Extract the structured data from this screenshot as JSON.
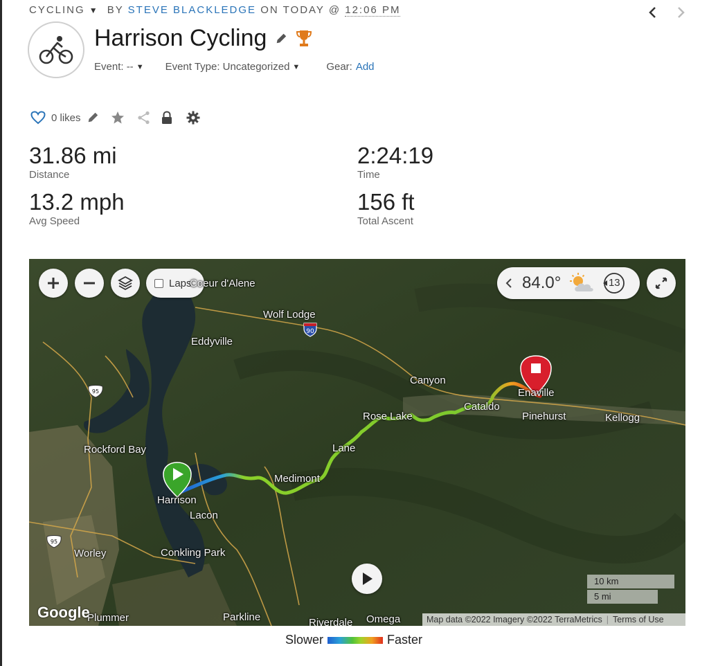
{
  "header": {
    "activity_type": "CYCLING",
    "by_label": "BY",
    "author": "STEVE BLACKLEDGE",
    "on_label": "ON TODAY @",
    "time": "12:06 PM"
  },
  "activity": {
    "title": "Harrison Cycling",
    "event_label": "Event: --",
    "event_type_label": "Event Type: Uncategorized",
    "gear_label": "Gear:",
    "gear_add": "Add"
  },
  "actions": {
    "likes": "0 likes"
  },
  "stats": {
    "distance": {
      "value": "31.86 mi",
      "label": "Distance"
    },
    "time": {
      "value": "2:24:19",
      "label": "Time"
    },
    "avg_speed": {
      "value": "13.2 mph",
      "label": "Avg Speed"
    },
    "total_ascent": {
      "value": "156 ft",
      "label": "Total Ascent"
    }
  },
  "map": {
    "laps_label": "Laps",
    "weather": {
      "temp": "84.0°",
      "wind": "13",
      "icon": "partly-cloudy-icon"
    },
    "places": [
      "Coeur d'Alene",
      "Wolf Lodge",
      "Eddyville",
      "Canyon",
      "Enaville",
      "Cataldo",
      "Rose Lake",
      "Pinehurst",
      "Kellogg",
      "Lane",
      "Rockford Bay",
      "Medimont",
      "Harrison",
      "Lacon",
      "Worley",
      "Conkling Park",
      "Plummer",
      "Parkline",
      "Riverdale",
      "Omega"
    ],
    "highways": [
      "90",
      "95",
      "95"
    ],
    "scale": [
      "10 km",
      "5 mi"
    ],
    "google": "Google",
    "attribution": "Map data ©2022 Imagery ©2022 TerraMetrics",
    "terms": "Terms of Use"
  },
  "legend": {
    "slower": "Slower",
    "faster": "Faster"
  },
  "colors": {
    "accent": "#2a74b8",
    "start_marker": "#3aa52a",
    "end_marker": "#d81e2c",
    "trophy": "#e07a1b"
  }
}
